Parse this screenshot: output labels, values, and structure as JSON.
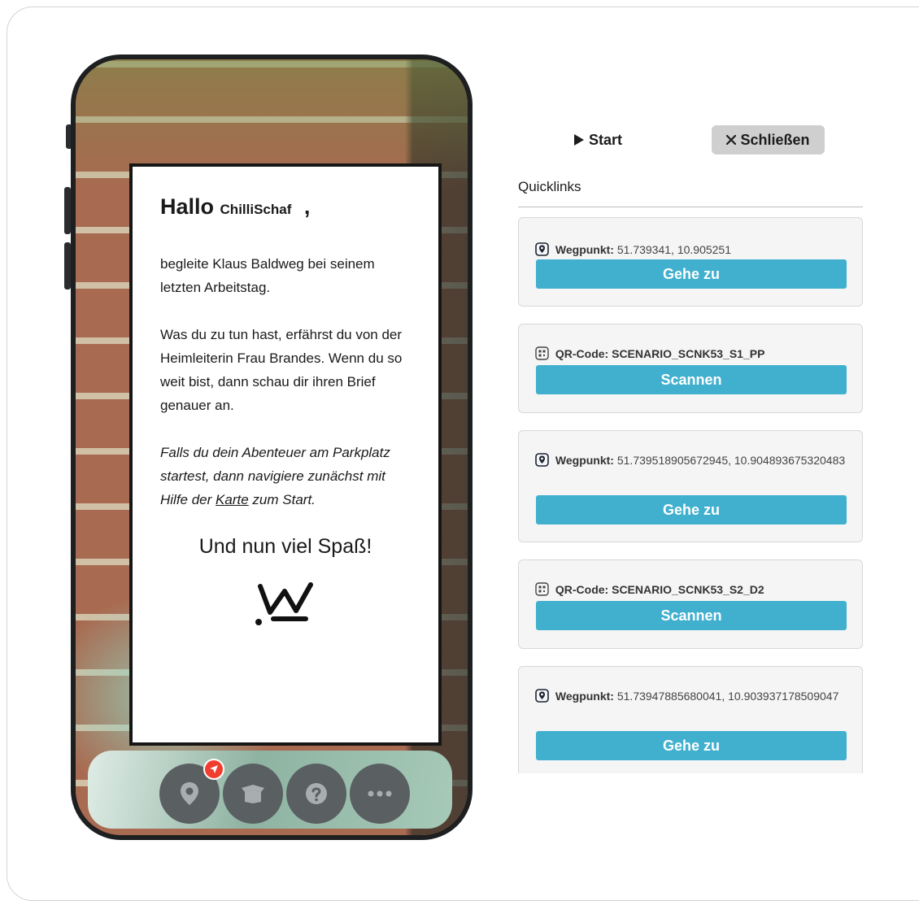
{
  "game": {
    "greeting": "Hallo",
    "username": "ChilliSchaf",
    "greeting_comma": ",",
    "para1": "begleite Klaus Baldweg bei seinem letzten Arbeitstag.",
    "para2": "Was du zu tun hast, erfährst du von der Heimleiterin Frau Brandes. Wenn du so weit bist, dann schau dir ihren Brief genauer an.",
    "para3_before": "Falls du dein Abenteuer am Parkplatz startest, dann navigiere zunächst mit Hilfe der",
    "para3_link": "Karte",
    "para3_after": "zum Start.",
    "closing": "Und nun viel Spaß!",
    "logo_icon": "crown-logo-icon"
  },
  "tabbar": {
    "items": [
      {
        "icon": "map-marker-icon",
        "badge_icon": "navigation-arrow-icon"
      },
      {
        "icon": "box-icon"
      },
      {
        "icon": "help-icon"
      },
      {
        "icon": "more-icon"
      }
    ],
    "badge_color": "#ef3d2f"
  },
  "controls": {
    "start_label": "Start",
    "close_label": "Schließen"
  },
  "quicklinks": {
    "title": "Quicklinks",
    "items": [
      {
        "type_label": "Wegpunkt:",
        "value": "51.739341, 10.905251",
        "button": "Gehe zu",
        "icon": "map-pin-icon"
      },
      {
        "type_label": "QR-Code:",
        "value": "SCENARIO_SCNK53_S1_PP",
        "button": "Scannen",
        "icon": "qr-code-icon"
      },
      {
        "type_label": "Wegpunkt:",
        "value": "51.739518905672945, 10.904893675320483",
        "button": "Gehe zu",
        "icon": "map-pin-icon"
      },
      {
        "type_label": "QR-Code:",
        "value": "SCENARIO_SCNK53_S2_D2",
        "button": "Scannen",
        "icon": "qr-code-icon"
      },
      {
        "type_label": "Wegpunkt:",
        "value": "51.73947885680041, 10.903937178509047",
        "button": "Gehe zu",
        "icon": "map-pin-icon"
      }
    ]
  },
  "colors": {
    "accent": "#41b0cf",
    "close_button_bg": "#cfcfcf"
  }
}
